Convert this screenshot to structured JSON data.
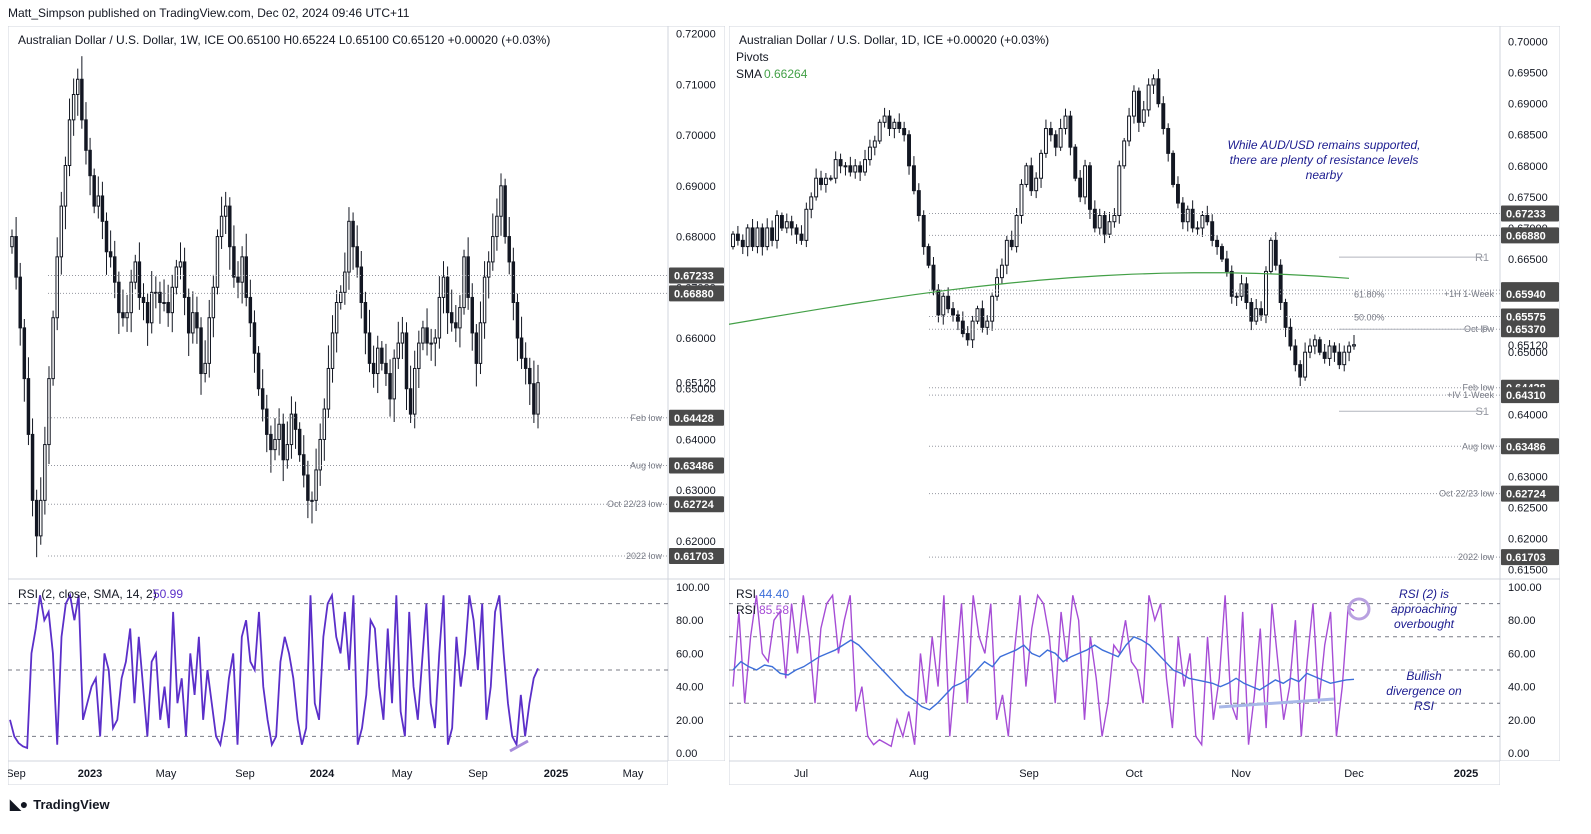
{
  "header": "Matt_Simpson published on TradingView.com, Dec 02, 2024 09:46 UTC+11",
  "footer": {
    "logo_icon": "tradingview-logo-icon",
    "brand": "TradingView"
  },
  "colors": {
    "grid_border": "#d1d4dc",
    "candle": "#131722",
    "sma": "#43a047",
    "rsi_weekly": "#5b2fc9",
    "rsi_daily_fast": "#a64dd6",
    "rsi_daily_slow": "#3d6fd9",
    "annotation": "#1b1b8f",
    "label_bg": "#4a4a4a"
  },
  "chart_data": [
    {
      "type": "candlestick",
      "title": "Australian Dollar / U.S. Dollar, 1W, ICE",
      "ohlc_text": "O0.65100  H0.65224  L0.65100  C0.65120  +0.00020 (+0.03%)",
      "ylim": [
        0.6125,
        0.7215
      ],
      "y_ticks": [
        "0.72000",
        "0.71000",
        "0.70000",
        "0.69000",
        "0.68000",
        "0.67000",
        "0.66000",
        "0.65000",
        "0.64000",
        "0.63000",
        "0.62000"
      ],
      "x_ticks": [
        "Sep",
        "2023",
        "May",
        "Sep",
        "2024",
        "May",
        "Sep",
        "2025",
        "May"
      ],
      "levels": [
        {
          "value": 0.67233,
          "label": "",
          "price": "0.67233"
        },
        {
          "value": 0.6688,
          "label": "",
          "price": "0.66880"
        },
        {
          "value": 0.64428,
          "label": "Feb low",
          "price": "0.64428"
        },
        {
          "value": 0.63486,
          "label": "Aug low",
          "price": "0.63486"
        },
        {
          "value": 0.62724,
          "label": "Oct 22/23 low",
          "price": "0.62724"
        },
        {
          "value": 0.61703,
          "label": "2022 low",
          "price": "0.61703"
        }
      ],
      "last_price": "0.65120",
      "series_closes": [
        0.68,
        0.672,
        0.662,
        0.652,
        0.641,
        0.628,
        0.621,
        0.628,
        0.639,
        0.652,
        0.664,
        0.676,
        0.686,
        0.694,
        0.703,
        0.708,
        0.711,
        0.703,
        0.697,
        0.692,
        0.686,
        0.688,
        0.683,
        0.677,
        0.676,
        0.671,
        0.665,
        0.664,
        0.665,
        0.671,
        0.675,
        0.668,
        0.667,
        0.663,
        0.669,
        0.669,
        0.667,
        0.667,
        0.665,
        0.67,
        0.674,
        0.675,
        0.668,
        0.661,
        0.665,
        0.662,
        0.653,
        0.655,
        0.664,
        0.67,
        0.68,
        0.684,
        0.686,
        0.678,
        0.672,
        0.671,
        0.676,
        0.668,
        0.663,
        0.657,
        0.65,
        0.646,
        0.641,
        0.638,
        0.64,
        0.643,
        0.636,
        0.639,
        0.645,
        0.642,
        0.637,
        0.633,
        0.628,
        0.628,
        0.634,
        0.64,
        0.646,
        0.654,
        0.661,
        0.667,
        0.669,
        0.673,
        0.683,
        0.678,
        0.674,
        0.667,
        0.661,
        0.655,
        0.653,
        0.658,
        0.655,
        0.653,
        0.648,
        0.656,
        0.659,
        0.661,
        0.65,
        0.645,
        0.654,
        0.659,
        0.662,
        0.659,
        0.659,
        0.66,
        0.668,
        0.672,
        0.665,
        0.663,
        0.662,
        0.666,
        0.676,
        0.668,
        0.661,
        0.655,
        0.663,
        0.672,
        0.675,
        0.68,
        0.684,
        0.69,
        0.68,
        0.675,
        0.667,
        0.66,
        0.656,
        0.654,
        0.651,
        0.645,
        0.6512
      ],
      "rsi": {
        "label": "RSI (2, close, SMA, 14, 2)",
        "value": "50.99",
        "ylim": [
          0,
          100
        ],
        "y_ticks": [
          "100.00",
          "80.00",
          "60.00",
          "40.00",
          "20.00",
          "0.00"
        ],
        "levels": [
          90,
          50,
          10
        ],
        "values": [
          20,
          10,
          6,
          4,
          3,
          60,
          75,
          95,
          80,
          85,
          60,
          5,
          70,
          90,
          95,
          80,
          95,
          20,
          30,
          40,
          45,
          10,
          60,
          50,
          15,
          20,
          45,
          55,
          75,
          30,
          70,
          40,
          10,
          55,
          60,
          20,
          40,
          15,
          85,
          30,
          45,
          10,
          60,
          35,
          70,
          20,
          50,
          30,
          10,
          5,
          20,
          45,
          60,
          5,
          70,
          80,
          55,
          50,
          85,
          40,
          20,
          5,
          10,
          55,
          70,
          60,
          45,
          20,
          5,
          15,
          95,
          30,
          20,
          70,
          90,
          95,
          70,
          60,
          85,
          50,
          95,
          5,
          15,
          35,
          80,
          75,
          40,
          20,
          75,
          30,
          95,
          25,
          10,
          85,
          40,
          20,
          55,
          90,
          30,
          15,
          60,
          95,
          5,
          15,
          70,
          40,
          60,
          95,
          80,
          50,
          90,
          20,
          40,
          85,
          95,
          60,
          30,
          10,
          5,
          35,
          10,
          30,
          45,
          51
        ]
      }
    },
    {
      "type": "candlestick",
      "title": "Australian Dollar / U.S. Dollar, 1D, ICE",
      "ohlc_text": "+0.00020 (+0.03%)",
      "indicators": [
        "Pivots",
        "SMA"
      ],
      "sma_label": "SMA",
      "sma_value": "0.66264",
      "ylim": [
        0.6135,
        0.7025
      ],
      "y_ticks": [
        "0.70000",
        "0.69500",
        "0.69000",
        "0.68500",
        "0.68000",
        "0.67500",
        "0.67000",
        "0.66500",
        "0.66000",
        "0.65500",
        "0.65000",
        "0.64500",
        "0.64000",
        "0.63500",
        "0.63000",
        "0.62500",
        "0.62000",
        "0.61500"
      ],
      "x_ticks": [
        "Jul",
        "Aug",
        "Sep",
        "Oct",
        "Nov",
        "Dec",
        "2025"
      ],
      "annotation": "While AUD/USD remains supported, there are plenty of resistance levels nearby",
      "levels": [
        {
          "value": 0.67233,
          "label": "",
          "price": "0.67233"
        },
        {
          "value": 0.6688,
          "label": "",
          "price": "0.66880"
        },
        {
          "value": 0.66,
          "label": "",
          "price": "0.66000"
        },
        {
          "value": 0.6594,
          "label": "+1H 1-Week",
          "price": "0.65940"
        },
        {
          "value": 0.65575,
          "label": "",
          "price": "0.65575"
        },
        {
          "value": 0.6537,
          "label": "Oct low",
          "price": "0.65370"
        },
        {
          "value": 0.64428,
          "label": "Feb low",
          "price": "0.64428"
        },
        {
          "value": 0.6431,
          "label": "+IV 1-Week",
          "price": "0.64310"
        },
        {
          "value": 0.63486,
          "label": "Aug low",
          "price": "0.63486"
        },
        {
          "value": 0.62724,
          "label": "Oct 22/23 low",
          "price": "0.62724"
        },
        {
          "value": 0.61703,
          "label": "2022 low",
          "price": "0.61703"
        }
      ],
      "pivots": [
        {
          "name": "R1",
          "value": 0.6653
        },
        {
          "name": "P",
          "value": 0.6537
        },
        {
          "name": "S1",
          "value": 0.6405
        }
      ],
      "fib_labels": [
        {
          "label": "61.80%",
          "value": 0.6593
        },
        {
          "label": "50.00%",
          "value": 0.6556
        }
      ],
      "last_price": "0.65120",
      "series_closes": [
        0.669,
        0.668,
        0.667,
        0.67,
        0.667,
        0.67,
        0.667,
        0.67,
        0.668,
        0.672,
        0.67,
        0.671,
        0.67,
        0.669,
        0.668,
        0.673,
        0.675,
        0.678,
        0.677,
        0.678,
        0.678,
        0.681,
        0.68,
        0.68,
        0.679,
        0.68,
        0.679,
        0.681,
        0.683,
        0.684,
        0.687,
        0.688,
        0.686,
        0.687,
        0.686,
        0.685,
        0.68,
        0.676,
        0.672,
        0.667,
        0.664,
        0.66,
        0.656,
        0.659,
        0.657,
        0.656,
        0.655,
        0.653,
        0.652,
        0.655,
        0.657,
        0.654,
        0.655,
        0.659,
        0.662,
        0.664,
        0.668,
        0.667,
        0.672,
        0.677,
        0.68,
        0.676,
        0.678,
        0.682,
        0.686,
        0.685,
        0.683,
        0.686,
        0.688,
        0.683,
        0.678,
        0.675,
        0.68,
        0.673,
        0.67,
        0.672,
        0.669,
        0.671,
        0.672,
        0.68,
        0.684,
        0.688,
        0.692,
        0.687,
        0.689,
        0.693,
        0.694,
        0.69,
        0.686,
        0.682,
        0.677,
        0.674,
        0.671,
        0.673,
        0.67,
        0.67,
        0.672,
        0.671,
        0.668,
        0.667,
        0.665,
        0.663,
        0.659,
        0.659,
        0.661,
        0.658,
        0.655,
        0.657,
        0.656,
        0.663,
        0.668,
        0.664,
        0.658,
        0.654,
        0.651,
        0.648,
        0.646,
        0.65,
        0.651,
        0.652,
        0.65,
        0.649,
        0.651,
        0.65,
        0.648,
        0.65,
        0.651,
        0.6512
      ],
      "rsi": {
        "label_a": "RSI",
        "value_a": "44.40",
        "label_b": "RSI",
        "value_b": "85.58",
        "ylim": [
          0,
          100
        ],
        "y_ticks": [
          "100.00",
          "80.00",
          "60.00",
          "40.00",
          "20.00",
          "0.00"
        ],
        "levels": [
          90,
          70,
          50,
          30,
          10
        ],
        "fast_values": [
          40,
          85,
          30,
          70,
          95,
          60,
          55,
          80,
          85,
          45,
          90,
          60,
          95,
          70,
          30,
          75,
          90,
          95,
          60,
          80,
          95,
          25,
          40,
          10,
          5,
          8,
          6,
          4,
          20,
          10,
          25,
          5,
          60,
          30,
          70,
          40,
          95,
          10,
          50,
          90,
          30,
          95,
          70,
          60,
          90,
          20,
          35,
          10,
          60,
          95,
          40,
          75,
          95,
          90,
          70,
          30,
          85,
          55,
          95,
          80,
          20,
          70,
          45,
          10,
          30,
          65,
          60,
          80,
          55,
          50,
          30,
          95,
          80,
          90,
          45,
          15,
          70,
          40,
          60,
          10,
          5,
          70,
          20,
          45,
          95,
          30,
          20,
          85,
          5,
          35,
          75,
          15,
          90,
          55,
          20,
          40,
          80,
          10,
          55,
          90,
          30,
          65,
          85,
          10,
          40,
          88,
          85.58
        ],
        "slow_values": [
          50,
          55,
          52,
          50,
          53,
          52,
          48,
          47,
          50,
          52,
          55,
          58,
          60,
          62,
          65,
          68,
          65,
          60,
          55,
          50,
          45,
          40,
          35,
          32,
          28,
          26,
          30,
          35,
          40,
          42,
          45,
          50,
          55,
          52,
          58,
          60,
          62,
          65,
          60,
          58,
          62,
          60,
          55,
          58,
          60,
          62,
          65,
          62,
          60,
          58,
          65,
          70,
          68,
          65,
          60,
          55,
          50,
          48,
          45,
          44,
          43,
          42,
          40,
          42,
          45,
          42,
          40,
          38,
          41,
          44,
          42,
          45,
          43,
          48,
          46,
          44,
          42,
          43,
          44,
          44.4
        ]
      },
      "annotations_rsi": [
        {
          "text": "RSI (2) is approaching overbought"
        },
        {
          "text": "Bullish divergence on RSI"
        }
      ]
    }
  ]
}
